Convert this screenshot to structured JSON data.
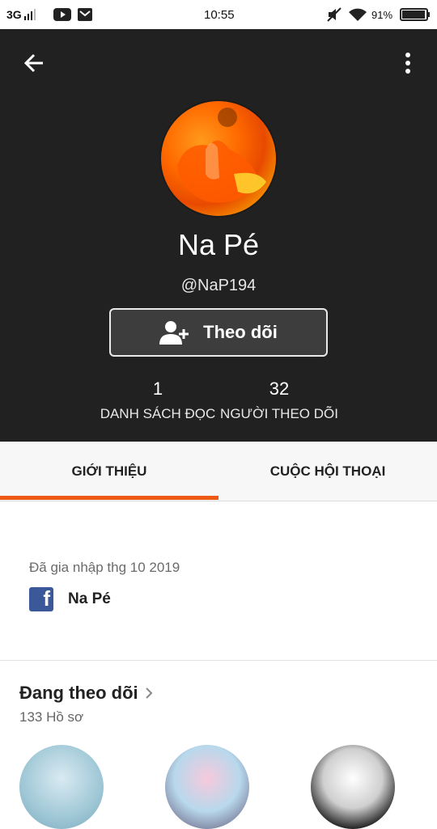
{
  "status_bar": {
    "network": "3G",
    "time": "10:55",
    "battery": "91%"
  },
  "profile": {
    "display_name": "Na Pé",
    "username": "@NaP194",
    "follow_button_label": "Theo dõi",
    "stats": [
      {
        "value": "1",
        "label": "DANH SÁCH ĐỌC"
      },
      {
        "value": "32",
        "label": "NGƯỜI THEO DÕI"
      }
    ]
  },
  "tabs": [
    {
      "label": "GIỚI THIỆU",
      "active": true
    },
    {
      "label": "CUỘC HỘI THOẠI",
      "active": false
    }
  ],
  "about": {
    "joined": "Đã gia nhập thg 10 2019",
    "facebook_name": "Na Pé",
    "facebook_icon_letter": "f"
  },
  "following": {
    "title": "Đang theo dõi",
    "count_text": "133 Hồ sơ"
  },
  "colors": {
    "accent": "#ec5a16",
    "header_bg": "#212121",
    "facebook": "#3b5998"
  },
  "icons": {
    "back": "back-arrow-icon",
    "more": "more-vertical-icon",
    "follow": "add-user-icon",
    "chevron": "chevron-right-icon"
  }
}
